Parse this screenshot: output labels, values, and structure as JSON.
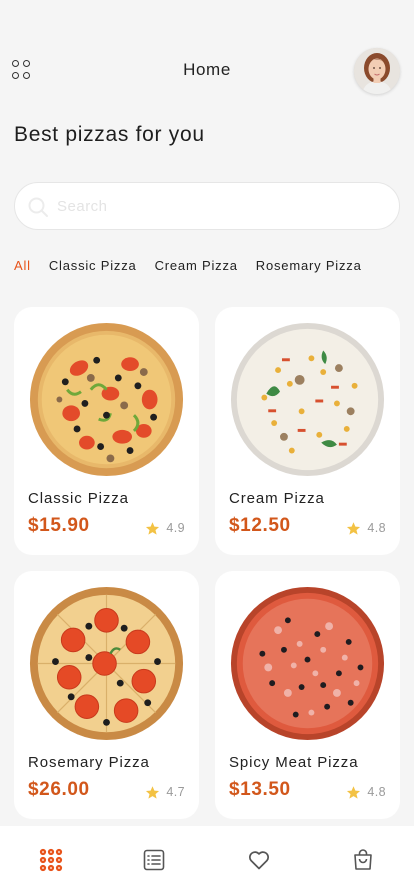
{
  "header": {
    "title": "Home",
    "menu_icon": "grid-menu-icon",
    "avatar_icon": "user-avatar"
  },
  "headline": "Best pizzas for you",
  "search": {
    "placeholder": "Search",
    "value": "",
    "icon": "search-icon"
  },
  "categories": [
    {
      "label": "All",
      "active": true
    },
    {
      "label": "Classic Pizza",
      "active": false
    },
    {
      "label": "Cream Pizza",
      "active": false
    },
    {
      "label": "Rosemary Pizza",
      "active": false
    }
  ],
  "products": [
    {
      "name": "Classic Pizza",
      "price": "$15.90",
      "rating": "4.9",
      "image": "classic-pizza-image"
    },
    {
      "name": "Cream Pizza",
      "price": "$12.50",
      "rating": "4.8",
      "image": "cream-pizza-image"
    },
    {
      "name": "Rosemary Pizza",
      "price": "$26.00",
      "rating": "4.7",
      "image": "rosemary-pizza-image"
    },
    {
      "name": "Spicy Meat Pizza",
      "price": "$13.50",
      "rating": "4.8",
      "image": "spicy-meat-pizza-image"
    }
  ],
  "bottom_nav": [
    {
      "icon": "grid-dots-icon",
      "active": true
    },
    {
      "icon": "list-icon",
      "active": false
    },
    {
      "icon": "heart-icon",
      "active": false
    },
    {
      "icon": "shopping-bag-icon",
      "active": false
    }
  ],
  "colors": {
    "accent": "#e8531a",
    "price": "#d2571b",
    "star": "#f3c244",
    "background": "#f5f5f5",
    "card": "#ffffff"
  }
}
